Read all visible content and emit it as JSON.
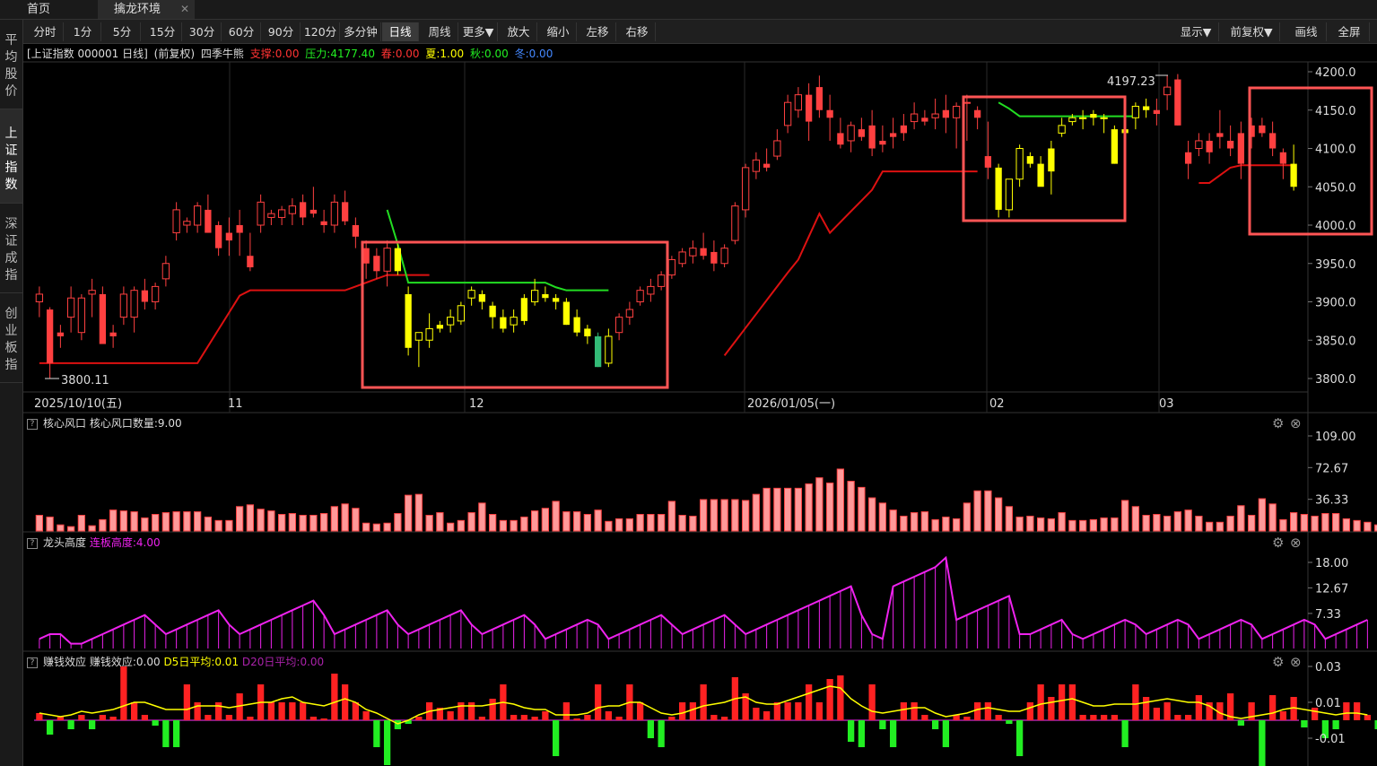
{
  "tabs": [
    {
      "label": "首页"
    },
    {
      "label": "擒龙环境"
    }
  ],
  "sidebar": [
    {
      "label": "平均股价",
      "lines": [
        "平",
        "均",
        "股",
        "价"
      ]
    },
    {
      "label": "上证指数",
      "lines": [
        "上",
        "证",
        "指",
        "数"
      ]
    },
    {
      "label": "深证成指",
      "lines": [
        "深",
        "证",
        "成",
        "指"
      ]
    },
    {
      "label": "创业板指",
      "lines": [
        "创",
        "业",
        "板",
        "指"
      ]
    }
  ],
  "toolbar": {
    "periods": [
      "分时",
      "1分",
      "5分",
      "15分",
      "30分",
      "60分",
      "90分",
      "120分",
      "多分钟",
      "日线",
      "周线",
      "更多▼"
    ],
    "actions": [
      "放大",
      "缩小",
      "左移",
      "右移"
    ],
    "right": [
      "显示▼",
      "前复权▼",
      "画线",
      "全屏"
    ],
    "selected": "日线"
  },
  "main_title": {
    "name": "[上证指数 000001 日线]",
    "adj": "(前复权)",
    "indicator": "四季牛熊",
    "support": "支撑:0.00",
    "pressure": "压力:4177.40",
    "spring": "春:0.00",
    "summer": "夏:1.00",
    "autumn": "秋:0.00",
    "winter": "冬:0.00"
  },
  "colors": {
    "up": "#ff4040",
    "down_yellow": "#ffff00",
    "green": "#22dd22",
    "magenta": "#ee22ee",
    "highlight": "#ff5555"
  },
  "price_axis": [
    "4200.0",
    "4150.0",
    "4100.0",
    "4050.0",
    "4000.0",
    "3950.0",
    "3900.0",
    "3850.0",
    "3800.0"
  ],
  "price_annotations": {
    "high": "4197.23",
    "low": "3800.11"
  },
  "date_axis": [
    "2025/10/10(五)",
    "11",
    "12",
    "2026/01/05(一)",
    "02",
    "03"
  ],
  "panel1": {
    "title": "核心风口",
    "value_label": "核心风口数量:9.00",
    "axis": [
      "109.00",
      "72.67",
      "36.33"
    ]
  },
  "panel2": {
    "title": "龙头高度",
    "value_label": "连板高度:4.00",
    "axis": [
      "18.00",
      "12.67",
      "7.33"
    ]
  },
  "panel3": {
    "title": "赚钱效应",
    "value_label": "赚钱效应:0.00",
    "d5": "D5日平均:0.01",
    "d20": "D20日平均:0.00",
    "axis": [
      "0.03",
      "0.01",
      "-0.01"
    ]
  },
  "chart_data": {
    "type": "candlestick",
    "title": "上证指数 000001 日线",
    "ylim": [
      3790,
      4210
    ],
    "candles": [
      [
        3900,
        3920,
        3880,
        3910
      ],
      [
        3890,
        3893,
        3800,
        3820
      ],
      [
        3860,
        3870,
        3840,
        3855
      ],
      [
        3880,
        3920,
        3860,
        3905
      ],
      [
        3860,
        3910,
        3850,
        3905
      ],
      [
        3910,
        3930,
        3880,
        3915
      ],
      [
        3910,
        3920,
        3855,
        3845
      ],
      [
        3860,
        3870,
        3840,
        3855
      ],
      [
        3880,
        3920,
        3870,
        3910
      ],
      [
        3880,
        3920,
        3860,
        3915
      ],
      [
        3915,
        3930,
        3890,
        3900
      ],
      [
        3900,
        3925,
        3890,
        3920
      ],
      [
        3930,
        3960,
        3920,
        3950
      ],
      [
        3990,
        4030,
        3980,
        4020
      ],
      [
        4000,
        4010,
        3990,
        4005
      ],
      [
        4000,
        4030,
        3990,
        4025
      ],
      [
        4020,
        4040,
        3990,
        3990
      ],
      [
        4000,
        4005,
        3960,
        3970
      ],
      [
        3990,
        4010,
        3960,
        3980
      ],
      [
        4000,
        4020,
        3960,
        3990
      ],
      [
        3960,
        3990,
        3940,
        3945
      ],
      [
        4000,
        4040,
        3990,
        4030
      ],
      [
        4010,
        4020,
        4000,
        4015
      ],
      [
        4010,
        4025,
        4000,
        4020
      ],
      [
        4015,
        4035,
        4000,
        4025
      ],
      [
        4030,
        4040,
        4000,
        4010
      ],
      [
        4020,
        4050,
        4010,
        4015
      ],
      [
        4005,
        4020,
        3990,
        4000
      ],
      [
        4000,
        4040,
        3990,
        4030
      ],
      [
        4030,
        4045,
        4000,
        4005
      ],
      [
        4000,
        4010,
        3970,
        3985
      ],
      [
        3970,
        3980,
        3930,
        3950
      ],
      [
        3960,
        3970,
        3930,
        3940
      ],
      [
        3940,
        3980,
        3920,
        3970
      ],
      [
        3970,
        3975,
        3935,
        3940
      ],
      [
        3910,
        3920,
        3830,
        3840
      ],
      [
        3850,
        3860,
        3815,
        3860
      ],
      [
        3850,
        3885,
        3840,
        3865
      ],
      [
        3870,
        3875,
        3860,
        3865
      ],
      [
        3870,
        3890,
        3860,
        3880
      ],
      [
        3875,
        3900,
        3870,
        3895
      ],
      [
        3905,
        3920,
        3895,
        3915
      ],
      [
        3910,
        3915,
        3890,
        3900
      ],
      [
        3895,
        3900,
        3865,
        3880
      ],
      [
        3880,
        3890,
        3860,
        3865
      ],
      [
        3870,
        3890,
        3860,
        3880
      ],
      [
        3905,
        3910,
        3870,
        3875
      ],
      [
        3900,
        3930,
        3895,
        3915
      ],
      [
        3910,
        3920,
        3900,
        3905
      ],
      [
        3905,
        3910,
        3890,
        3900
      ],
      [
        3900,
        3905,
        3870,
        3870
      ],
      [
        3880,
        3890,
        3855,
        3860
      ],
      [
        3865,
        3870,
        3845,
        3855
      ],
      [
        3855,
        3860,
        3815,
        3815
      ],
      [
        3820,
        3865,
        3815,
        3855
      ],
      [
        3860,
        3885,
        3850,
        3880
      ],
      [
        3880,
        3900,
        3870,
        3890
      ],
      [
        3900,
        3920,
        3895,
        3915
      ],
      [
        3910,
        3930,
        3900,
        3920
      ],
      [
        3920,
        3940,
        3915,
        3935
      ],
      [
        3935,
        3960,
        3930,
        3955
      ],
      [
        3950,
        3970,
        3945,
        3965
      ],
      [
        3960,
        3980,
        3950,
        3970
      ],
      [
        3970,
        3990,
        3955,
        3960
      ],
      [
        3965,
        3980,
        3940,
        3950
      ],
      [
        3950,
        3975,
        3945,
        3970
      ],
      [
        3980,
        4030,
        3975,
        4025
      ],
      [
        4020,
        4080,
        4010,
        4075
      ],
      [
        4070,
        4095,
        4060,
        4085
      ],
      [
        4080,
        4100,
        4070,
        4075
      ],
      [
        4090,
        4125,
        4085,
        4110
      ],
      [
        4130,
        4170,
        4120,
        4160
      ],
      [
        4150,
        4180,
        4140,
        4170
      ],
      [
        4170,
        4185,
        4110,
        4135
      ],
      [
        4180,
        4195,
        4140,
        4150
      ],
      [
        4150,
        4170,
        4110,
        4140
      ],
      [
        4120,
        4140,
        4100,
        4105
      ],
      [
        4110,
        4135,
        4095,
        4130
      ],
      [
        4125,
        4140,
        4110,
        4115
      ],
      [
        4130,
        4150,
        4090,
        4100
      ],
      [
        4110,
        4130,
        4095,
        4105
      ],
      [
        4120,
        4140,
        4100,
        4115
      ],
      [
        4130,
        4145,
        4110,
        4120
      ],
      [
        4135,
        4160,
        4125,
        4145
      ],
      [
        4140,
        4150,
        4130,
        4135
      ],
      [
        4140,
        4165,
        4125,
        4145
      ],
      [
        4150,
        4170,
        4120,
        4140
      ],
      [
        4140,
        4160,
        4100,
        4155
      ],
      [
        4160,
        4170,
        4110,
        4160
      ],
      [
        4150,
        4155,
        4125,
        4140
      ],
      [
        4090,
        4135,
        4060,
        4075
      ],
      [
        4075,
        4080,
        4010,
        4020
      ],
      [
        4020,
        4055,
        4010,
        4060
      ],
      [
        4060,
        4105,
        4050,
        4100
      ],
      [
        4090,
        4095,
        4075,
        4080
      ],
      [
        4080,
        4090,
        4055,
        4050
      ],
      [
        4100,
        4110,
        4040,
        4070
      ],
      [
        4120,
        4140,
        4115,
        4130
      ],
      [
        4135,
        4145,
        4130,
        4140
      ],
      [
        4140,
        4150,
        4125,
        4140
      ],
      [
        4145,
        4150,
        4130,
        4140
      ],
      [
        4140,
        4145,
        4120,
        4140
      ],
      [
        4125,
        4130,
        4080,
        4080
      ],
      [
        4125,
        4135,
        4110,
        4120
      ],
      [
        4140,
        4160,
        4125,
        4155
      ],
      [
        4155,
        4165,
        4140,
        4150
      ],
      [
        4150,
        4165,
        4130,
        4145
      ],
      [
        4170,
        4195,
        4150,
        4180
      ],
      [
        4190,
        4197,
        4130,
        4130
      ],
      [
        4095,
        4110,
        4060,
        4080
      ],
      [
        4100,
        4120,
        4090,
        4110
      ],
      [
        4110,
        4120,
        4080,
        4095
      ],
      [
        4120,
        4150,
        4100,
        4115
      ],
      [
        4110,
        4130,
        4090,
        4100
      ],
      [
        4120,
        4135,
        4060,
        4080
      ],
      [
        4130,
        4140,
        4100,
        4115
      ],
      [
        4130,
        4140,
        4115,
        4120
      ],
      [
        4120,
        4135,
        4090,
        4100
      ],
      [
        4095,
        4100,
        4060,
        4080
      ],
      [
        4080,
        4105,
        4045,
        4050
      ]
    ],
    "support_line_note": "red line",
    "pressure_line_note": "green line",
    "panel1_values": [
      18,
      16,
      7,
      5,
      18,
      6,
      13,
      24,
      23,
      22,
      15,
      19,
      21,
      22,
      22,
      22,
      16,
      12,
      12,
      28,
      30,
      25,
      23,
      19,
      20,
      18,
      18,
      20,
      28,
      31,
      26,
      9,
      8,
      9,
      20,
      41,
      42,
      18,
      21,
      9,
      12,
      21,
      32,
      19,
      12,
      12,
      16,
      23,
      26,
      34,
      22,
      22,
      19,
      24,
      11,
      14,
      14,
      19,
      19,
      19,
      34,
      18,
      17,
      36,
      36,
      36,
      36,
      35,
      42,
      49,
      49,
      49,
      49,
      54,
      61,
      55,
      71,
      57,
      50,
      38,
      32,
      24,
      17,
      21,
      22,
      13,
      16,
      14,
      32,
      46,
      46,
      38,
      28,
      16,
      17,
      15,
      14,
      21,
      12,
      12,
      13,
      15,
      15,
      35,
      28,
      18,
      19,
      17,
      22,
      24,
      17,
      10,
      10,
      17,
      29,
      18,
      37,
      31,
      13,
      21,
      19,
      17,
      20,
      20,
      14,
      12,
      10,
      7
    ],
    "panel2_values": [
      2,
      3,
      3,
      1,
      1,
      2,
      3,
      4,
      5,
      6,
      7,
      5,
      3,
      4,
      5,
      6,
      7,
      8,
      5,
      3,
      4,
      5,
      6,
      7,
      8,
      9,
      10,
      7,
      3,
      4,
      5,
      6,
      7,
      8,
      5,
      3,
      4,
      5,
      6,
      7,
      8,
      5,
      3,
      4,
      5,
      6,
      7,
      5,
      2,
      3,
      4,
      5,
      6,
      5,
      2,
      3,
      4,
      5,
      6,
      7,
      5,
      3,
      4,
      5,
      6,
      7,
      5,
      3,
      4,
      5,
      6,
      7,
      8,
      9,
      10,
      11,
      12,
      13,
      7,
      3,
      2,
      13,
      14,
      15,
      16,
      17,
      19,
      6,
      7,
      8,
      9,
      10,
      11,
      3,
      3,
      4,
      5,
      6,
      3,
      2,
      3,
      4,
      5,
      6,
      5,
      3,
      4,
      5,
      6,
      5,
      2,
      3,
      4,
      5,
      6,
      5,
      2,
      3,
      4,
      5,
      6,
      5,
      2,
      3,
      4,
      5,
      6
    ],
    "panel3_values": [
      0.004,
      -0.008,
      0.002,
      -0.005,
      0.003,
      -0.005,
      0.003,
      0.002,
      0.03,
      0.01,
      0.003,
      -0.003,
      -0.015,
      -0.015,
      0.02,
      0.01,
      0.003,
      0.01,
      0.003,
      0.015,
      0.002,
      0.02,
      0.01,
      0.01,
      0.01,
      0.01,
      0.002,
      0.001,
      0.026,
      0.02,
      0.01,
      0.005,
      -0.015,
      -0.025,
      -0.005,
      -0.002,
      0.002,
      0.01,
      0.007,
      0.005,
      0.01,
      0.01,
      0.002,
      0.012,
      0.02,
      0.003,
      0.003,
      0.002,
      0.005,
      -0.02,
      0.01,
      0.001,
      0.003,
      0.02,
      0.005,
      0.002,
      0.02,
      0.01,
      -0.01,
      -0.015,
      0.002,
      0.01,
      0.01,
      0.02,
      0.003,
      0.002,
      0.024,
      0.015,
      0.007,
      0.005,
      0.01,
      0.01,
      0.01,
      0.02,
      0.01,
      0.023,
      0.025,
      -0.012,
      -0.015,
      0.02,
      -0.005,
      -0.015,
      0.01,
      0.01,
      0.003,
      -0.005,
      -0.015,
      0.003,
      0.002,
      0.01,
      0.01,
      0.003,
      -0.002,
      -0.02,
      0.01,
      0.02,
      0.013,
      0.02,
      0.02,
      0.003,
      0.003,
      0.003,
      0.003,
      -0.015,
      0.02,
      0.013,
      0.007,
      0.01,
      0.003,
      0.003,
      0.014,
      0.01,
      0.01,
      0.015,
      -0.003,
      0.01,
      -0.03,
      0.014,
      0.005,
      0.013,
      -0.004,
      0.007,
      -0.01,
      -0.005,
      0.01,
      0.01,
      0.003,
      -0.005,
      0.007,
      0.003
    ],
    "panel3_ma5": [
      0.004,
      0.003,
      0.002,
      0.003,
      0.005,
      0.004,
      0.005,
      0.006,
      0.008,
      0.01,
      0.01,
      0.008,
      0.006,
      0.006,
      0.006,
      0.008,
      0.008,
      0.008,
      0.007,
      0.008,
      0.009,
      0.01,
      0.01,
      0.012,
      0.013,
      0.01,
      0.009,
      0.008,
      0.01,
      0.012,
      0.01,
      0.006,
      0.004,
      0.001,
      -0.002,
      0.0,
      0.003,
      0.005,
      0.006,
      0.007,
      0.008,
      0.008,
      0.008,
      0.009,
      0.01,
      0.009,
      0.007,
      0.006,
      0.006,
      0.003,
      0.003,
      0.003,
      0.004,
      0.007,
      0.008,
      0.008,
      0.01,
      0.01,
      0.007,
      0.004,
      0.003,
      0.004,
      0.006,
      0.008,
      0.009,
      0.01,
      0.012,
      0.013,
      0.01,
      0.009,
      0.009,
      0.011,
      0.013,
      0.015,
      0.017,
      0.019,
      0.018,
      0.012,
      0.008,
      0.005,
      0.004,
      0.005,
      0.006,
      0.007,
      0.007,
      0.004,
      0.002,
      0.003,
      0.004,
      0.006,
      0.007,
      0.006,
      0.005,
      0.005,
      0.007,
      0.009,
      0.01,
      0.011,
      0.012,
      0.01,
      0.008,
      0.008,
      0.009,
      0.009,
      0.009,
      0.01,
      0.011,
      0.012,
      0.011,
      0.01,
      0.01,
      0.008,
      0.004,
      0.002,
      0.001,
      0.002,
      0.003,
      0.004,
      0.006,
      0.007,
      0.006,
      0.005,
      0.004,
      0.003,
      0.004,
      0.004,
      0.003
    ]
  }
}
